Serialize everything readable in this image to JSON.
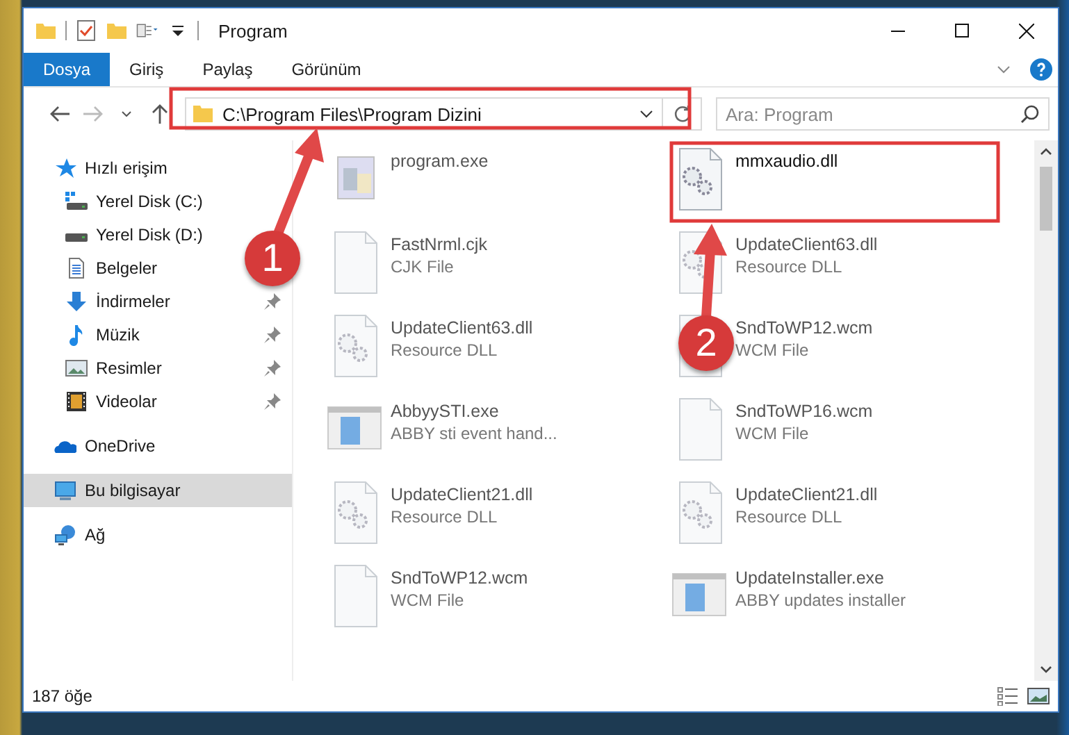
{
  "window": {
    "title": "Program"
  },
  "ribbon_tabs": [
    {
      "label": "Dosya",
      "selected": true
    },
    {
      "label": "Giriş",
      "selected": false
    },
    {
      "label": "Paylaş",
      "selected": false
    },
    {
      "label": "Görünüm",
      "selected": false
    }
  ],
  "address": {
    "path": "C:\\Program Files\\Program Dizini"
  },
  "search": {
    "placeholder": "Ara: Program"
  },
  "sidebar": {
    "items": [
      {
        "label": "Hızlı erişim",
        "kind": "star",
        "selected": false,
        "children": [
          {
            "label": "Yerel Disk (C:)",
            "kind": "drive-win",
            "pinned": false,
            "selected": false
          },
          {
            "label": "Yerel Disk (D:)",
            "kind": "drive",
            "pinned": false,
            "selected": false
          },
          {
            "label": "Belgeler",
            "kind": "document",
            "pinned": false,
            "selected": false
          },
          {
            "label": "İndirmeler",
            "kind": "download",
            "pinned": true,
            "selected": false
          },
          {
            "label": "Müzik",
            "kind": "music",
            "pinned": true,
            "selected": false
          },
          {
            "label": "Resimler",
            "kind": "picture",
            "pinned": true,
            "selected": false
          },
          {
            "label": "Videolar",
            "kind": "video",
            "pinned": true,
            "selected": false
          }
        ]
      },
      {
        "label": "OneDrive",
        "kind": "cloud",
        "selected": false
      },
      {
        "label": "Bu bilgisayar",
        "kind": "computer",
        "selected": true
      },
      {
        "label": "Ağ",
        "kind": "network",
        "selected": false
      }
    ]
  },
  "files": [
    {
      "name": "program.exe",
      "kind": "program",
      "blurred": true
    },
    {
      "name": "mmxaudio.dll",
      "kind": "dll",
      "blurred": false
    },
    {
      "name": "FastNrml.cjk",
      "type": "CJK File",
      "kind": "file",
      "blurred": true
    },
    {
      "name": "UpdateClient63.dll",
      "type": "Resource DLL",
      "kind": "dll",
      "blurred": true
    },
    {
      "name": "UpdateClient63.dll",
      "type": "Resource DLL",
      "kind": "dll",
      "blurred": true
    },
    {
      "name": "SndToWP12.wcm",
      "type": "WCM File",
      "kind": "file",
      "blurred": true
    },
    {
      "name": "AbbyySTI.exe",
      "type": "ABBY sti event hand...",
      "kind": "app",
      "blurred": true
    },
    {
      "name": "SndToWP16.wcm",
      "type": "WCM File",
      "kind": "file",
      "blurred": true
    },
    {
      "name": "UpdateClient21.dll",
      "type": "Resource DLL",
      "kind": "dll",
      "blurred": true
    },
    {
      "name": "UpdateClient21.dll",
      "type": "Resource DLL",
      "kind": "dll",
      "blurred": true
    },
    {
      "name": "SndToWP12.wcm",
      "type": "WCM File",
      "kind": "file",
      "blurred": true
    },
    {
      "name": "UpdateInstaller.exe",
      "type": "ABBY updates installer",
      "kind": "app",
      "blurred": true
    }
  ],
  "status_bar": {
    "count": "187 öğe"
  },
  "annotations": [
    {
      "label": "1"
    },
    {
      "label": "2"
    }
  ]
}
